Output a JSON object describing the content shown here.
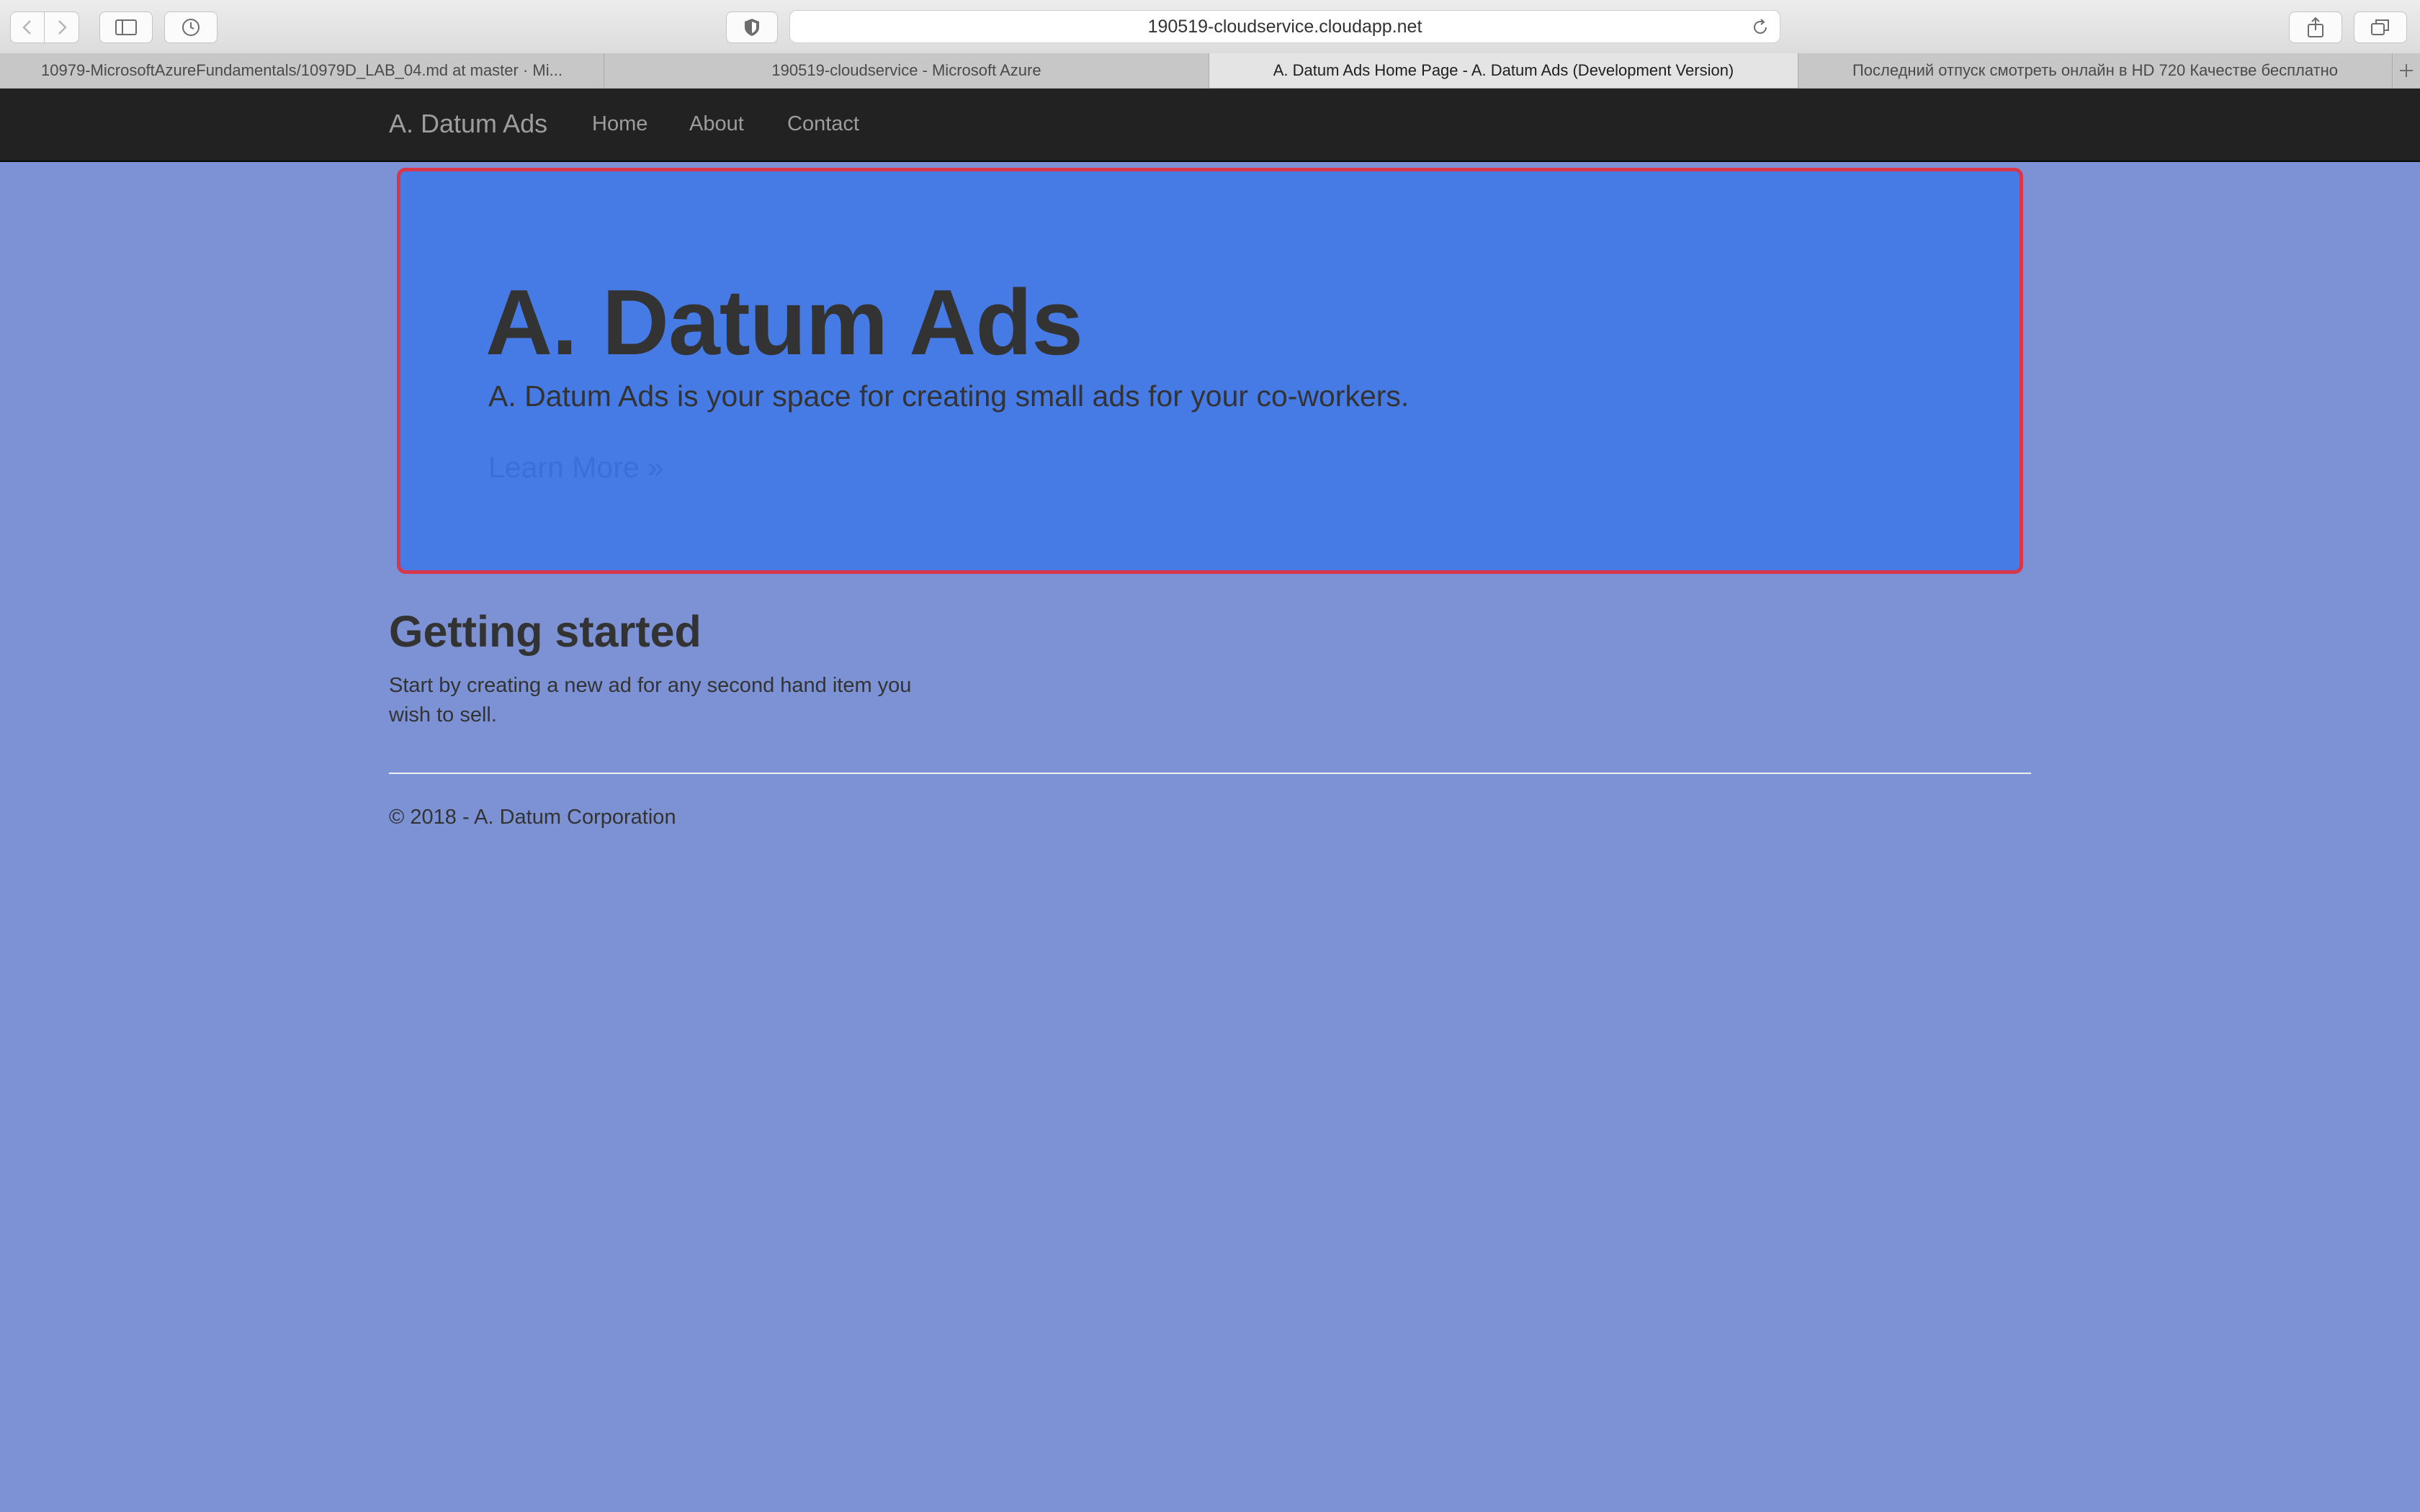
{
  "browser": {
    "url": "190519-cloudservice.cloudapp.net",
    "icons": {
      "back": "chevron-left-icon",
      "forward": "chevron-right-icon",
      "sidebar": "sidebar-icon",
      "history": "clock-icon",
      "privacy": "shield-icon",
      "reload": "reload-icon",
      "share": "share-icon",
      "tabs_overview": "tabs-overview-icon",
      "new_tab": "plus-icon"
    },
    "tabs": [
      {
        "label": "10979-MicrosoftAzureFundamentals/10979D_LAB_04.md at master · Mi..."
      },
      {
        "label": "190519-cloudservice - Microsoft Azure"
      },
      {
        "label": "A. Datum Ads Home Page - A. Datum Ads (Development Version)",
        "active": true
      },
      {
        "label": "Последний отпуск смотреть онлайн в HD 720 Качестве бесплатно"
      }
    ]
  },
  "navbar": {
    "brand": "A. Datum Ads",
    "links": [
      "Home",
      "About",
      "Contact"
    ],
    "background": "#222222"
  },
  "jumbotron": {
    "title": "A. Datum Ads",
    "lead": "A. Datum Ads is your space for creating small ads for your co-workers.",
    "link": "Learn More »",
    "background": "#467be6",
    "border_color": "#d7364b"
  },
  "getting_started": {
    "title": "Getting started",
    "text": "Start by creating a new ad for any second hand item you wish to sell."
  },
  "footer": {
    "text": "© 2018 - A. Datum Corporation"
  },
  "page_background": "#7c92d4"
}
